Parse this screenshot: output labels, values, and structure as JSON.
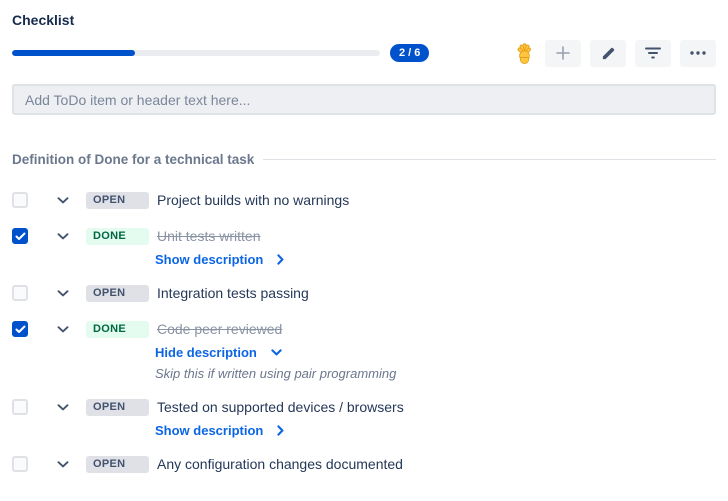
{
  "title": "Checklist",
  "progress": {
    "completed": 2,
    "total": 6,
    "label": "2 / 6",
    "percent": 33.33
  },
  "toolbar": {
    "icons": [
      "hand-icon",
      "plus-icon",
      "pencil-icon",
      "filter-icon",
      "ellipsis-icon"
    ],
    "buttons": [
      "add-item",
      "edit",
      "filter",
      "more-options"
    ]
  },
  "input": {
    "placeholder": "Add ToDo item or header text here..."
  },
  "section": {
    "title": "Definition of Done for a technical task"
  },
  "items": [
    {
      "checked": false,
      "status": "OPEN",
      "text": "Project builds with no warnings"
    },
    {
      "checked": true,
      "status": "DONE",
      "text": "Unit tests written",
      "toggle": "Show description",
      "toggle_icon": "chevron-right"
    },
    {
      "checked": false,
      "status": "OPEN",
      "text": "Integration tests passing"
    },
    {
      "checked": true,
      "status": "DONE",
      "text": "Code peer reviewed",
      "toggle": "Hide description",
      "toggle_icon": "chevron-down",
      "description": "Skip this if written using pair programming"
    },
    {
      "checked": false,
      "status": "OPEN",
      "text": "Tested on supported devices / browsers",
      "toggle": "Show description",
      "toggle_icon": "chevron-right"
    },
    {
      "checked": false,
      "status": "OPEN",
      "text": "Any configuration changes documented"
    }
  ],
  "colors": {
    "accent_blue": "#0052CC",
    "link_blue": "#0C66E4",
    "done_badge_bg": "#E3FCEF",
    "done_badge_text": "#006644",
    "open_badge_bg": "#DFE1E6",
    "open_badge_text": "#42526E",
    "done_text": "#8993A4",
    "hand_yellow": "#FFC53D"
  }
}
